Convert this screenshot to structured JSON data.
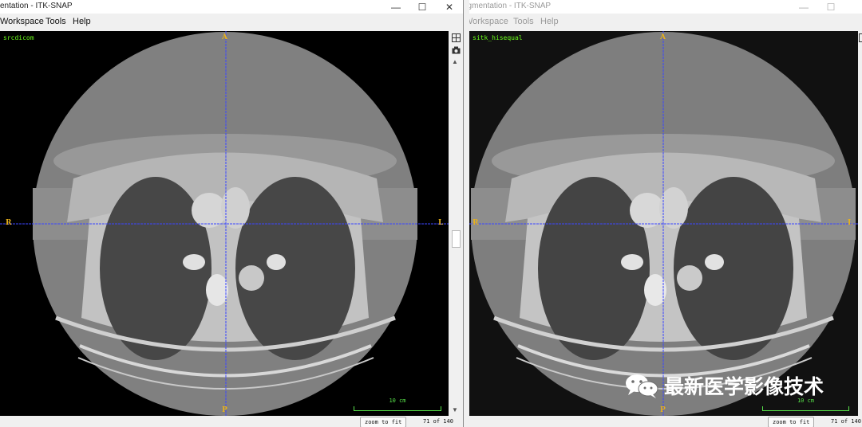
{
  "windows": [
    {
      "title": "entation - ITK-SNAP",
      "menus": [
        "Workspace",
        "Tools",
        "Help"
      ],
      "layer_name": "srcdicom",
      "orientation": {
        "top": "A",
        "bottom": "P",
        "left": "R",
        "right": "L"
      },
      "scale_label": "10 cm",
      "zoom_button": "zoom to fit",
      "slice_counter": "71 of 140"
    },
    {
      "title": "egmentation - ITK-SNAP",
      "menus": [
        "Workspace",
        "Tools",
        "Help"
      ],
      "layer_name": "sitk_hisequal",
      "orientation": {
        "top": "A",
        "bottom": "P",
        "left": "R",
        "right": "L"
      },
      "scale_label": "10 cm",
      "zoom_button": "zoom to fit",
      "slice_counter": "71 of 140"
    }
  ],
  "window_controls": {
    "minimize": "—",
    "maximize": "☐",
    "close": "✕"
  },
  "watermark": {
    "text": "最新医学影像技术",
    "icon": "wechat-icon"
  },
  "colors": {
    "crosshair": "#3b46ff",
    "orientation_label": "#e8b11c",
    "layer_name": "#6cff1a",
    "scale_bar": "#58e24a"
  }
}
